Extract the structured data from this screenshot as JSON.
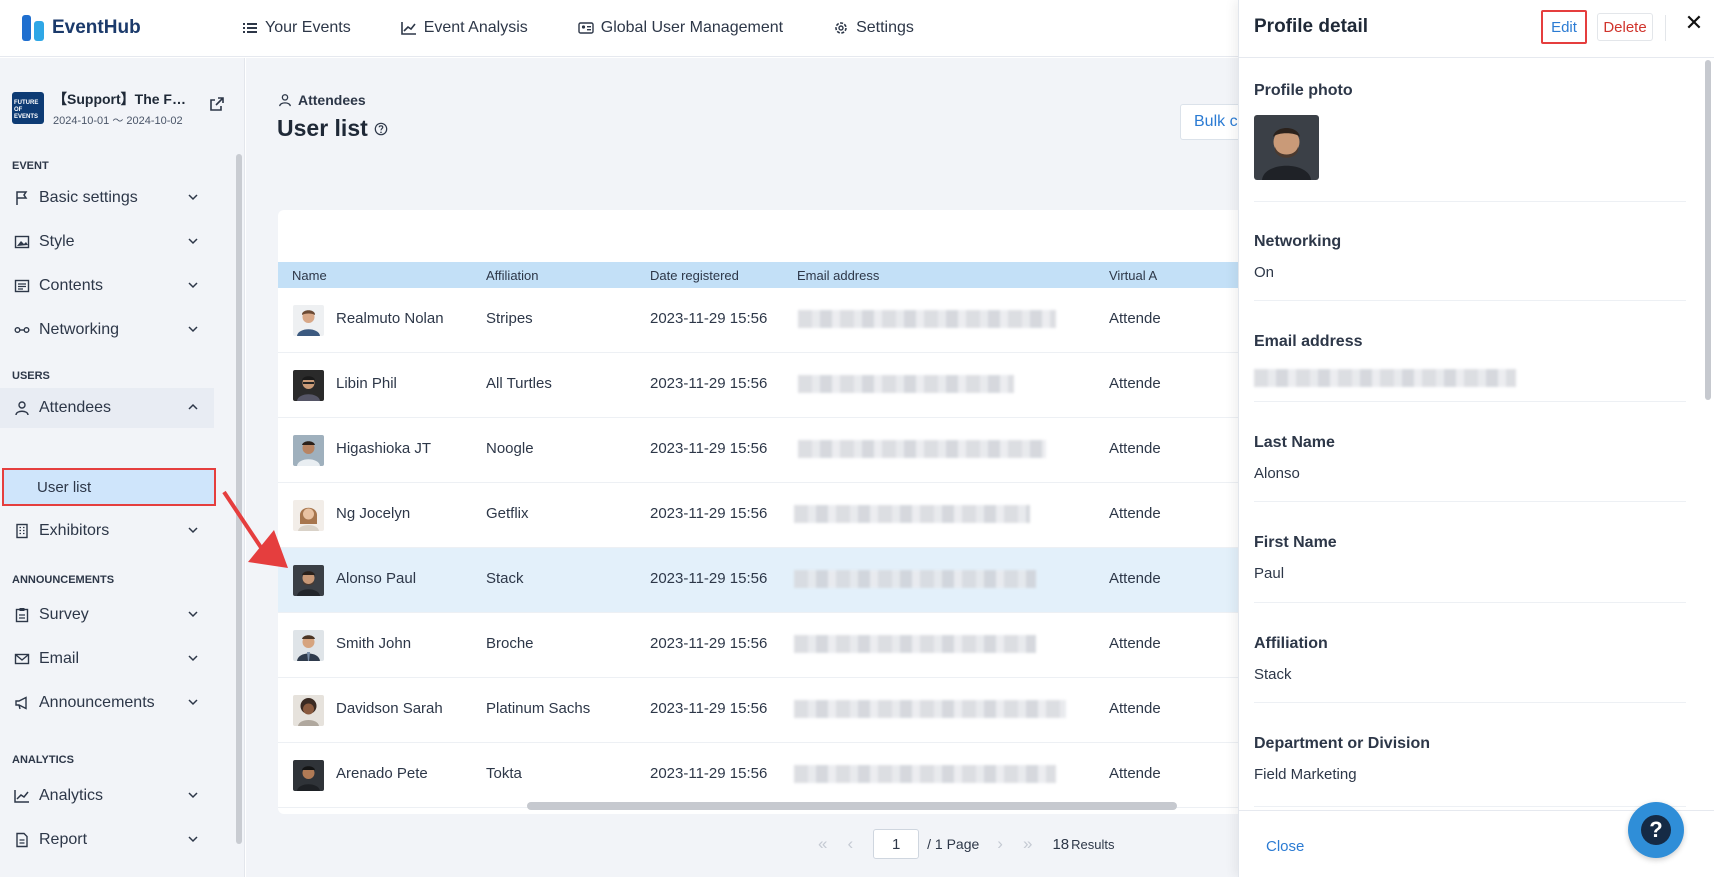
{
  "app": {
    "name": "EventHub"
  },
  "nav": {
    "items": [
      {
        "label": "Your Events",
        "icon": "list-icon"
      },
      {
        "label": "Event Analysis",
        "icon": "chart-icon"
      },
      {
        "label": "Global User Management",
        "icon": "id-card-icon"
      },
      {
        "label": "Settings",
        "icon": "gear-icon"
      }
    ]
  },
  "event": {
    "thumb": "FUTURE OF EVENTS",
    "title": "【Support】The F…",
    "dates": "2024-10-01 ～ 2024-10-02"
  },
  "sidebar": {
    "sections": {
      "event": "EVENT",
      "users": "USERS",
      "announcements": "ANNOUNCEMENTS",
      "analytics": "ANALYTICS"
    },
    "items": {
      "basic": "Basic settings",
      "style": "Style",
      "contents": "Contents",
      "networking": "Networking",
      "attendees": "Attendees",
      "userlist": "User list",
      "exhibitors": "Exhibitors",
      "survey": "Survey",
      "email": "Email",
      "announcements": "Announcements",
      "analytics": "Analytics",
      "report": "Report"
    }
  },
  "main": {
    "breadcrumb": "Attendees",
    "title": "User list",
    "bulk_button": "Bulk c",
    "columns": {
      "name": "Name",
      "affiliation": "Affiliation",
      "date": "Date registered",
      "email": "Email address",
      "virtual": "Virtual A"
    },
    "rows": [
      {
        "name": "Realmuto Nolan",
        "affiliation": "Stripes",
        "date": "2023-11-29 15:56",
        "virtual": "Attende"
      },
      {
        "name": "Libin Phil",
        "affiliation": "All Turtles",
        "date": "2023-11-29 15:56",
        "virtual": "Attende"
      },
      {
        "name": "Higashioka JT",
        "affiliation": "Noogle",
        "date": "2023-11-29 15:56",
        "virtual": "Attende"
      },
      {
        "name": "Ng Jocelyn",
        "affiliation": "Getflix",
        "date": "2023-11-29 15:56",
        "virtual": "Attende"
      },
      {
        "name": "Alonso Paul",
        "affiliation": "Stack",
        "date": "2023-11-29 15:56",
        "virtual": "Attende"
      },
      {
        "name": "Smith John",
        "affiliation": "Broche",
        "date": "2023-11-29 15:56",
        "virtual": "Attende"
      },
      {
        "name": "Davidson Sarah",
        "affiliation": "Platinum Sachs",
        "date": "2023-11-29 15:56",
        "virtual": "Attende"
      },
      {
        "name": "Arenado Pete",
        "affiliation": "Tokta",
        "date": "2023-11-29 15:56",
        "virtual": "Attende"
      }
    ],
    "pager": {
      "first": "«",
      "prev": "‹",
      "page": "1",
      "page_label": "/ 1 Page",
      "next": "›",
      "last": "»",
      "count": "18",
      "results": "Results"
    }
  },
  "panel": {
    "title": "Profile detail",
    "edit": "Edit",
    "delete": "Delete",
    "close_x": "✕",
    "fields": {
      "photo": "Profile photo",
      "networking": "Networking",
      "networking_value": "On",
      "email": "Email address",
      "lastname": "Last Name",
      "lastname_value": "Alonso",
      "firstname": "First Name",
      "firstname_value": "Paul",
      "affiliation": "Affiliation",
      "affiliation_value": "Stack",
      "department": "Department or Division",
      "department_value": "Field Marketing"
    },
    "close_link": "Close"
  },
  "help_fab": "?"
}
